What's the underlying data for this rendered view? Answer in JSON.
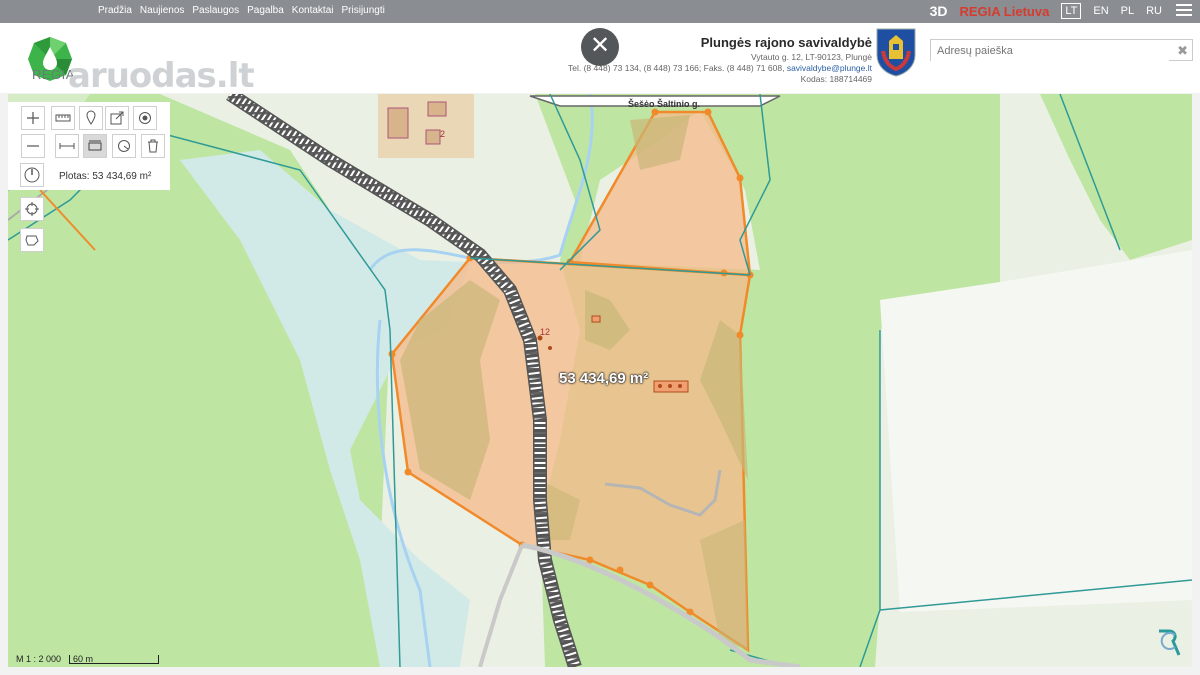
{
  "nav": {
    "items": [
      "Pradžia",
      "Naujienos",
      "Paslaugos",
      "Pagalba",
      "Kontaktai",
      "Prisijungti"
    ],
    "btn_3d": "3D",
    "regia_lietuva": "REGIA Lietuva",
    "languages": [
      "LT",
      "EN",
      "PL",
      "RU"
    ],
    "active_language": "LT"
  },
  "header": {
    "logo_text": "REGIA",
    "watermark": "aruodas.lt",
    "close_symbol": "✕",
    "municipality": {
      "name": "Plungės rajono savivaldybė",
      "address": "Vytauto g. 12, LT-90123, Plungė",
      "phones": "Tel. (8 448) 73 134, (8 448) 73 166; Faks. (8 448) 71 608,",
      "email": "savivaldybe@plunge.lt",
      "code": "Kodas: 188714469"
    }
  },
  "search": {
    "placeholder": "Adresų paieška",
    "value": ""
  },
  "map": {
    "street_label": "Šešėo Šaltinio g.",
    "area_label": "53 434,69 m²",
    "parcel_numbers": [
      "2",
      "12"
    ]
  },
  "tools": {
    "plotas_text": "Plotas: 53 434,69 m²"
  },
  "scale": {
    "ratio": "M 1 : 2 000",
    "bar_label": "60 m"
  },
  "colors": {
    "nav_bg": "#8a8d91",
    "brand_green": "#3cb44a",
    "regia_red": "#d63b2f",
    "polygon_fill": "#f5b98a",
    "polygon_stroke": "#f08a2a",
    "forest": "#bfe5a5",
    "water": "#cfe8ea"
  }
}
